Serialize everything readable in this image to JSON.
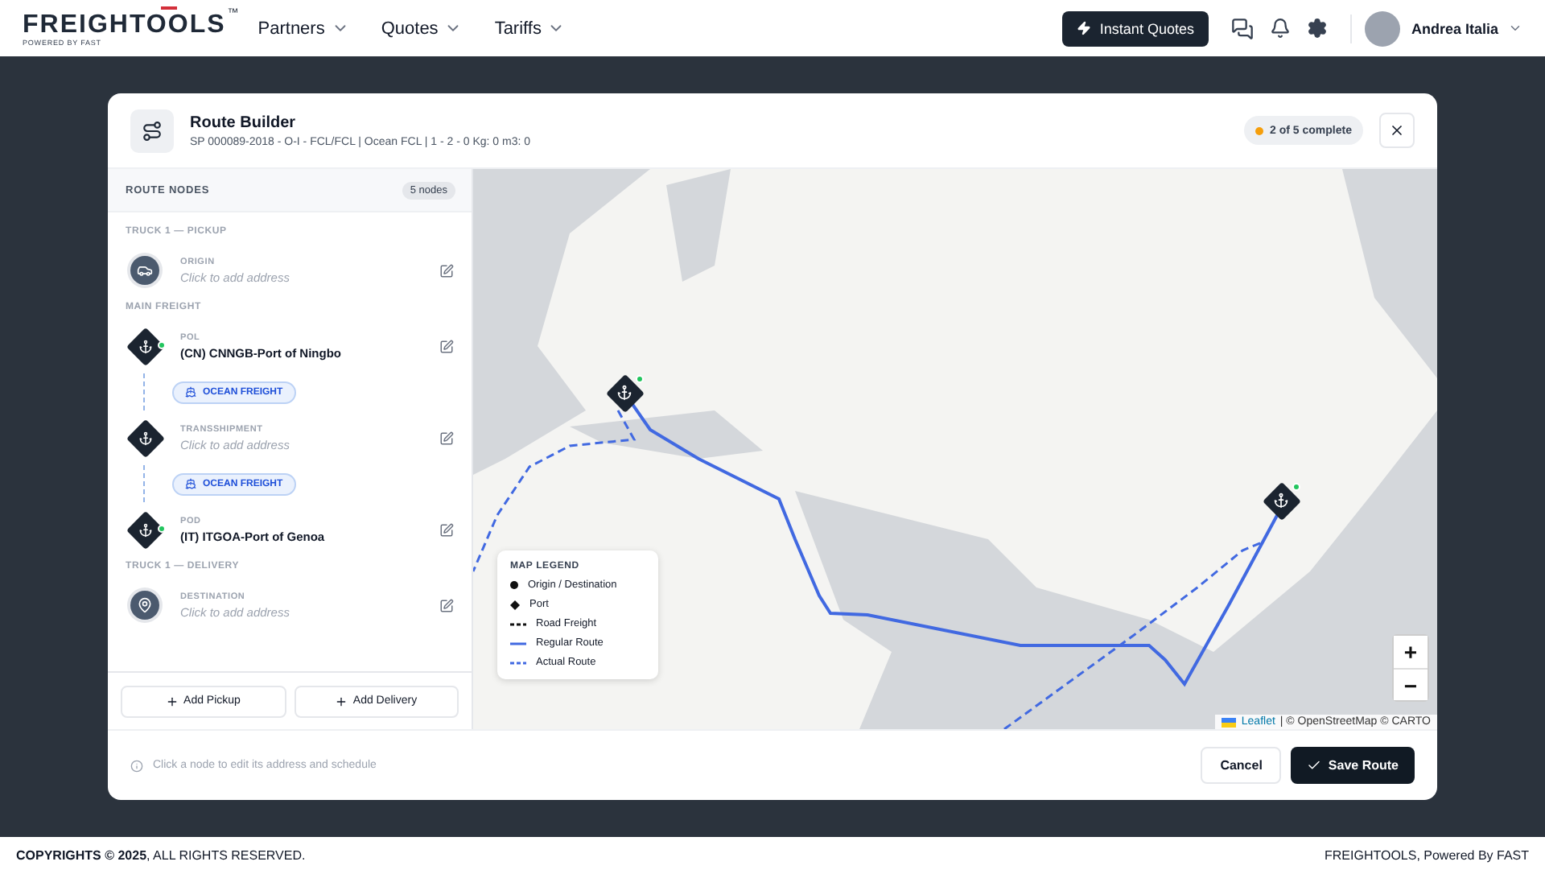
{
  "topbar": {
    "logo": {
      "name": "FREIGHTOOLS",
      "mark": "™",
      "tagline": "POWERED BY FAST"
    },
    "menu": [
      {
        "label": "Partners"
      },
      {
        "label": "Quotes"
      },
      {
        "label": "Tariffs"
      }
    ],
    "action": "Instant Quotes",
    "user": "Andrea Italia"
  },
  "modal": {
    "title": "Route Builder",
    "subtitle": "SP 000089-2018 - O-I - FCL/FCL | Ocean FCL | 1 - 2 - 0 Kg: 0 m3: 0",
    "progress": "2 of 5 complete",
    "sidebar": {
      "title": "ROUTE NODES",
      "count": "5 nodes",
      "groups": [
        {
          "label": "TRUCK 1 — PICKUP",
          "items": [
            {
              "kind": "origin",
              "type": "ORIGIN",
              "value": "Click to add address",
              "filled": false
            }
          ]
        },
        {
          "label": "MAIN FREIGHT",
          "items": [
            {
              "kind": "port",
              "type": "POL",
              "value": "(CN) CNNGB-Port of Ningbo",
              "filled": true,
              "confirmed": true
            },
            {
              "kind": "leg",
              "label": "OCEAN FREIGHT"
            },
            {
              "kind": "port",
              "type": "TRANSSHIPMENT",
              "value": "Click to add address",
              "filled": false,
              "confirmed": false
            },
            {
              "kind": "leg",
              "label": "OCEAN FREIGHT"
            },
            {
              "kind": "port",
              "type": "POD",
              "value": "(IT) ITGOA-Port of Genoa",
              "filled": true,
              "confirmed": true
            }
          ]
        },
        {
          "label": "TRUCK 1 — DELIVERY",
          "items": [
            {
              "kind": "destination",
              "type": "DESTINATION",
              "value": "Click to add address",
              "filled": false
            }
          ]
        }
      ],
      "buttons": [
        "Add Pickup",
        "Add Delivery"
      ]
    },
    "map": {
      "markers": [
        {
          "confirmed": true
        },
        {
          "confirmed": true
        }
      ],
      "legend": {
        "title": "MAP LEGEND",
        "items": [
          {
            "kind": "dot",
            "label": "Origin / Destination"
          },
          {
            "kind": "diamond",
            "label": "Port"
          },
          {
            "kind": "road",
            "label": "Road Freight"
          },
          {
            "kind": "regular",
            "label": "Regular Route"
          },
          {
            "kind": "actual",
            "label": "Actual Route"
          }
        ]
      },
      "zoom": [
        "+",
        "−"
      ],
      "attribution": {
        "link": "Leaflet",
        "text": "| © OpenStreetMap © CARTO"
      }
    },
    "hint": "Click a node to edit its address and schedule",
    "cancel": "Cancel",
    "save": "Save Route"
  },
  "footer": {
    "left": "**COPYRIGHTS © 2025**, ALL RIGHTS RESERVED.",
    "right": "FREIGHTOOLS, Powered By FAST"
  }
}
